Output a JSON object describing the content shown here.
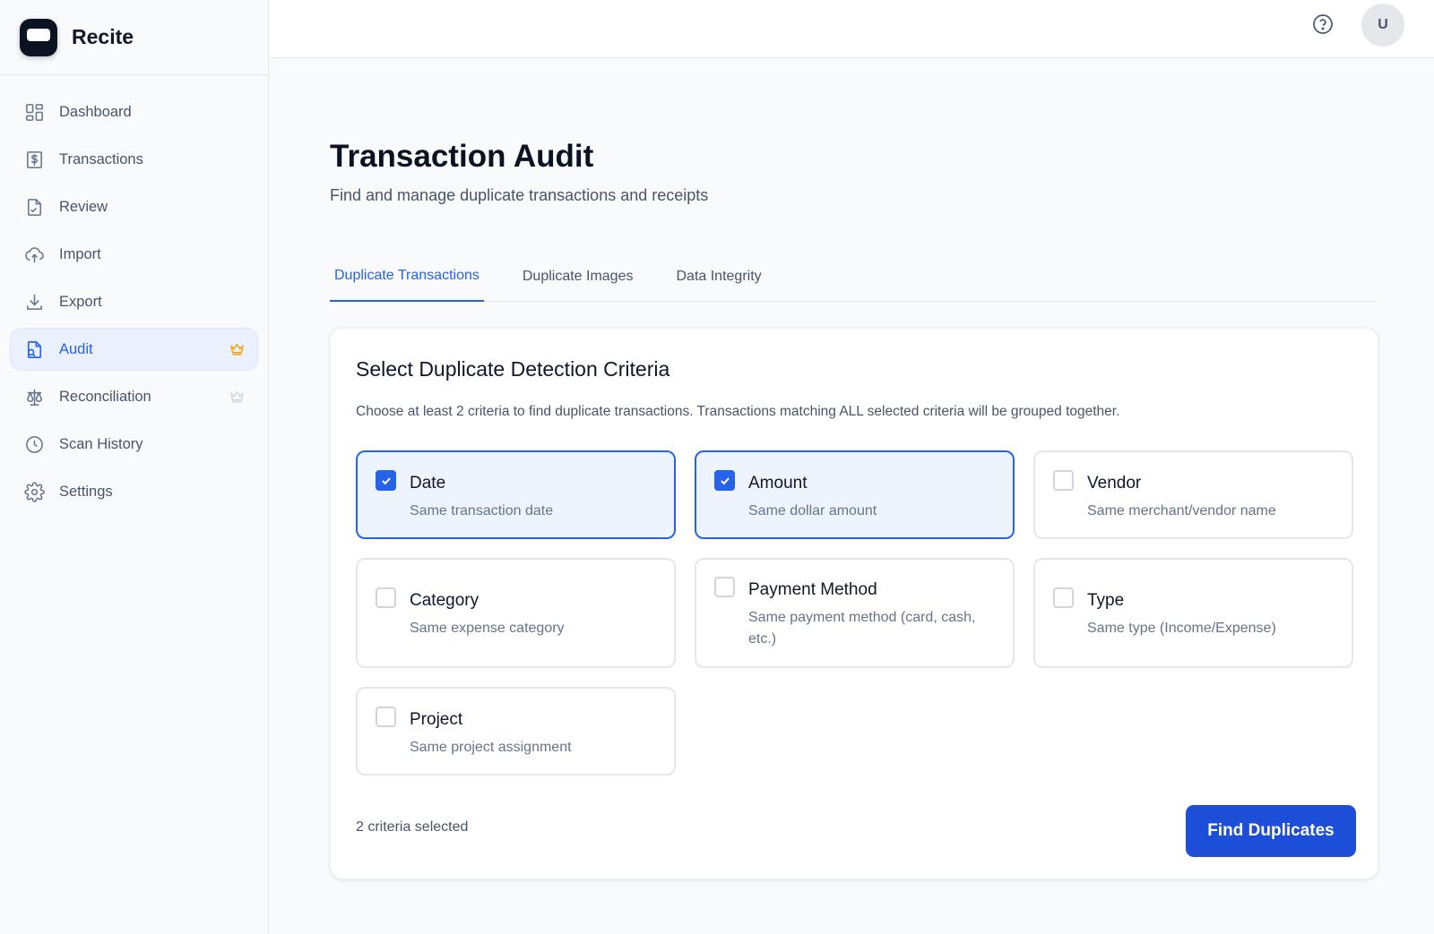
{
  "app": {
    "name": "Recite"
  },
  "sidebar": {
    "items": [
      {
        "label": "Dashboard",
        "icon": "dashboard-icon"
      },
      {
        "label": "Transactions",
        "icon": "dollar-doc-icon"
      },
      {
        "label": "Review",
        "icon": "review-icon"
      },
      {
        "label": "Import",
        "icon": "cloud-upload-icon"
      },
      {
        "label": "Export",
        "icon": "download-icon"
      },
      {
        "label": "Audit",
        "icon": "audit-icon",
        "active": true,
        "badge": "crown-icon"
      },
      {
        "label": "Reconciliation",
        "icon": "scale-icon",
        "badge": "crown-icon"
      },
      {
        "label": "Scan History",
        "icon": "clock-icon"
      },
      {
        "label": "Settings",
        "icon": "gear-icon"
      }
    ]
  },
  "header": {
    "avatar_initial": "U",
    "help_icon": "help-circle-icon"
  },
  "page": {
    "title": "Transaction Audit",
    "subtitle": "Find and manage duplicate transactions and receipts"
  },
  "tabs": [
    {
      "label": "Duplicate Transactions",
      "active": true
    },
    {
      "label": "Duplicate Images"
    },
    {
      "label": "Data Integrity"
    }
  ],
  "criteria_card": {
    "title": "Select Duplicate Detection Criteria",
    "description": "Choose at least 2 criteria to find duplicate transactions. Transactions matching ALL selected criteria will be grouped together.",
    "options": [
      {
        "title": "Date",
        "desc": "Same transaction date",
        "checked": true
      },
      {
        "title": "Amount",
        "desc": "Same dollar amount",
        "checked": true
      },
      {
        "title": "Vendor",
        "desc": "Same merchant/vendor name",
        "checked": false
      },
      {
        "title": "Category",
        "desc": "Same expense category",
        "checked": false
      },
      {
        "title": "Payment Method",
        "desc": "Same payment method (card, cash, etc.)",
        "checked": false
      },
      {
        "title": "Type",
        "desc": "Same type (Income/Expense)",
        "checked": false
      },
      {
        "title": "Project",
        "desc": "Same project assignment",
        "checked": false
      }
    ],
    "selected_count": "2 criteria selected",
    "find_button": "Find Duplicates"
  },
  "colors": {
    "accent": "#2563eb",
    "button": "#1d4ed8",
    "crown_active": "#f59e0b",
    "crown_inactive": "#cbd5e1"
  }
}
